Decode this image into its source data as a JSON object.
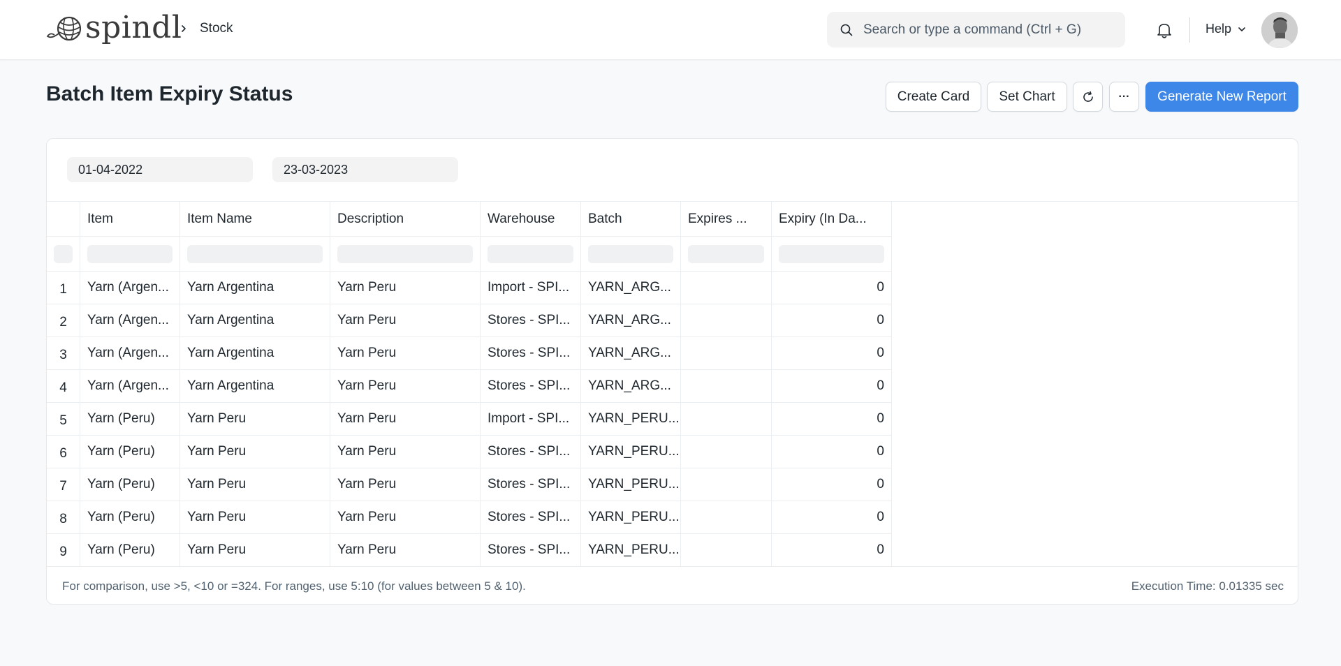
{
  "navbar": {
    "logo_text": "spindl",
    "breadcrumb": "Stock",
    "search_placeholder": "Search or type a command (Ctrl + G)",
    "help_label": "Help"
  },
  "page": {
    "title": "Batch Item Expiry Status",
    "buttons": {
      "create_card": "Create Card",
      "set_chart": "Set Chart",
      "more": "···",
      "generate": "Generate New Report"
    }
  },
  "filters": {
    "from_date": "01-04-2022",
    "to_date": "23-03-2023"
  },
  "table": {
    "columns": [
      "Item",
      "Item Name",
      "Description",
      "Warehouse",
      "Batch",
      "Expires ...",
      "Expiry (In Da..."
    ],
    "rows": [
      {
        "idx": "1",
        "item": "Yarn (Argen...",
        "item_name": "Yarn Argentina",
        "description": "Yarn Peru",
        "warehouse": "Import - SPI...",
        "batch": "YARN_ARG...",
        "expires": "",
        "expiry_days": "0"
      },
      {
        "idx": "2",
        "item": "Yarn (Argen...",
        "item_name": "Yarn Argentina",
        "description": "Yarn Peru",
        "warehouse": "Stores - SPI...",
        "batch": "YARN_ARG...",
        "expires": "",
        "expiry_days": "0"
      },
      {
        "idx": "3",
        "item": "Yarn (Argen...",
        "item_name": "Yarn Argentina",
        "description": "Yarn Peru",
        "warehouse": "Stores - SPI...",
        "batch": "YARN_ARG...",
        "expires": "",
        "expiry_days": "0"
      },
      {
        "idx": "4",
        "item": "Yarn (Argen...",
        "item_name": "Yarn Argentina",
        "description": "Yarn Peru",
        "warehouse": "Stores - SPI...",
        "batch": "YARN_ARG...",
        "expires": "",
        "expiry_days": "0"
      },
      {
        "idx": "5",
        "item": "Yarn (Peru)",
        "item_name": "Yarn Peru",
        "description": "Yarn Peru",
        "warehouse": "Import - SPI...",
        "batch": "YARN_PERU...",
        "expires": "",
        "expiry_days": "0"
      },
      {
        "idx": "6",
        "item": "Yarn (Peru)",
        "item_name": "Yarn Peru",
        "description": "Yarn Peru",
        "warehouse": "Stores - SPI...",
        "batch": "YARN_PERU...",
        "expires": "",
        "expiry_days": "0"
      },
      {
        "idx": "7",
        "item": "Yarn (Peru)",
        "item_name": "Yarn Peru",
        "description": "Yarn Peru",
        "warehouse": "Stores - SPI...",
        "batch": "YARN_PERU...",
        "expires": "",
        "expiry_days": "0"
      },
      {
        "idx": "8",
        "item": "Yarn (Peru)",
        "item_name": "Yarn Peru",
        "description": "Yarn Peru",
        "warehouse": "Stores - SPI...",
        "batch": "YARN_PERU...",
        "expires": "",
        "expiry_days": "0"
      },
      {
        "idx": "9",
        "item": "Yarn (Peru)",
        "item_name": "Yarn Peru",
        "description": "Yarn Peru",
        "warehouse": "Stores - SPI...",
        "batch": "YARN_PERU...",
        "expires": "",
        "expiry_days": "0"
      }
    ]
  },
  "footer": {
    "hint": "For comparison, use >5, <10 or =324. For ranges, use 5:10 (for values between 5 & 10).",
    "execution_time": "Execution Time: 0.01335 sec"
  },
  "icons": [
    "yarn-ball-logo-icon",
    "chevron-right-icon",
    "search-icon",
    "bell-icon",
    "chevron-down-icon",
    "refresh-icon"
  ],
  "colors": {
    "primary": "#3d87e8",
    "background": "#f8f9fa"
  }
}
